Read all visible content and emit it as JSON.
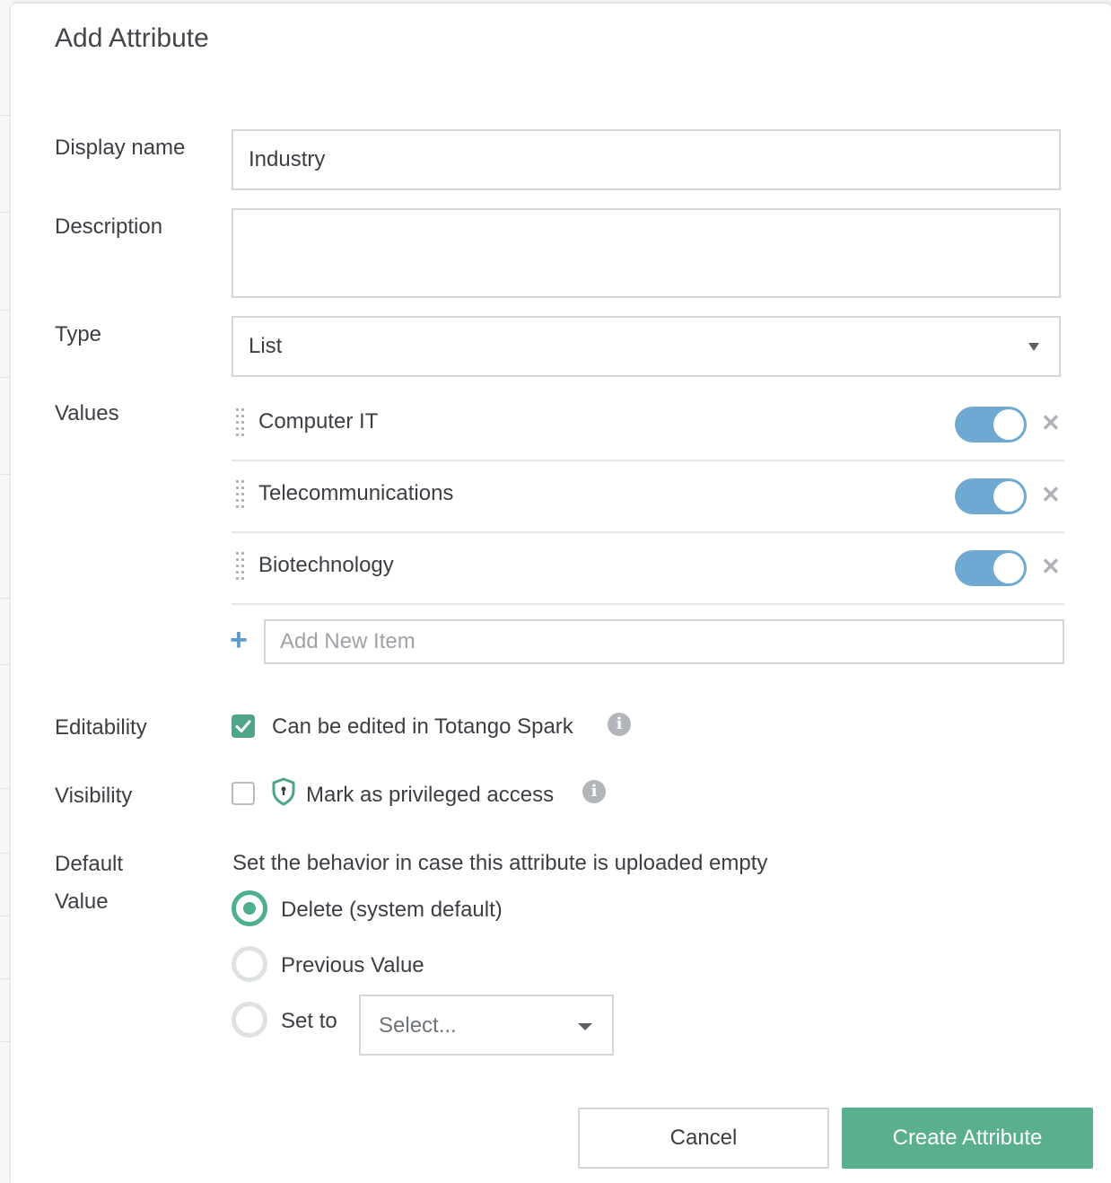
{
  "dialog": {
    "title": "Add Attribute"
  },
  "form": {
    "display_name": {
      "label": "Display name",
      "value": "Industry"
    },
    "description": {
      "label": "Description",
      "value": ""
    },
    "type": {
      "label": "Type",
      "value": "List"
    },
    "values": {
      "label": "Values",
      "items": [
        {
          "label": "Computer IT",
          "enabled": true
        },
        {
          "label": "Telecommunications",
          "enabled": true
        },
        {
          "label": "Biotechnology",
          "enabled": true
        }
      ],
      "add_placeholder": "Add New Item"
    },
    "editability": {
      "label": "Editability",
      "option_text": "Can be edited in Totango Spark",
      "checked": true
    },
    "visibility": {
      "label": "Visibility",
      "option_text": "Mark as privileged access",
      "checked": false
    },
    "default_value": {
      "label_line1": "Default",
      "label_line2": "Value",
      "hint": "Set the behavior in case this attribute is uploaded empty",
      "options": [
        {
          "label": "Delete (system default)",
          "selected": true
        },
        {
          "label": "Previous Value",
          "selected": false
        },
        {
          "label": "Set to",
          "selected": false
        }
      ],
      "set_to_placeholder": "Select..."
    }
  },
  "actions": {
    "cancel_label": "Cancel",
    "create_label": "Create Attribute"
  },
  "colors": {
    "primary_green": "#5aaf8f",
    "toggle_blue": "#6fa8d1",
    "border_gray": "#d4d7da"
  }
}
